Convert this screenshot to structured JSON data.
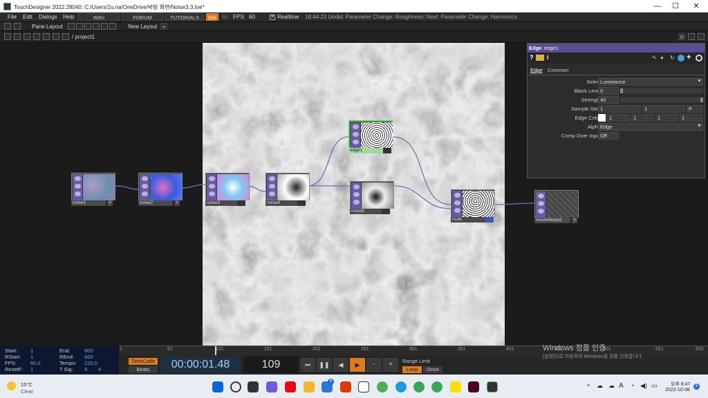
{
  "window": {
    "title": "TouchDesigner 2022.28040: C:/Users/2u.na/OneDrive/바탕 화면/Noise3.3.toe*",
    "controls": {
      "minimize": "—",
      "maximize": "☐",
      "close": "✕"
    }
  },
  "menu": {
    "items": [
      "File",
      "Edit",
      "Dialogs",
      "Help"
    ],
    "wiki": "WIKI",
    "forum": "FORUM",
    "tutorials": "TUTORIALS",
    "oh_label": "OH",
    "fps_target": "60",
    "fps_label": "FPS:",
    "fps_value": "60",
    "realtime_label": "Realtime",
    "undo_status": "18:44:23 Undid: Parameter Change: Roughness; Next: Parameter Change: Harmonics"
  },
  "toolbar": {
    "pane_layout": "Pane Layout",
    "new_layout": "New Layout",
    "plus": "+",
    "path": "/ project1",
    "right_0": "0"
  },
  "nodes": [
    {
      "label": "noise1",
      "thumb": "#7a8aa6"
    },
    {
      "label": "noise2",
      "thumb": "#4e6fd0"
    },
    {
      "label": "noise3",
      "thumb": "#7ab8e0"
    },
    {
      "label": "noise4",
      "thumb": "#bbbbbb"
    },
    {
      "label": "edge1",
      "thumb": "#cccccc"
    },
    {
      "label": "noise5",
      "thumb": "#aaaaaa"
    },
    {
      "label": "multi",
      "thumb": "#e8e8e8"
    },
    {
      "label": "moviefileout1",
      "thumb": "#444444"
    }
  ],
  "params": {
    "op_type": "Edge",
    "op_name": "edge1",
    "tabs": [
      "Edge",
      "Common"
    ],
    "rows": [
      {
        "label": "Select",
        "values": [
          "Luminance"
        ]
      },
      {
        "label": "Black Level",
        "values": [
          "0"
        ]
      },
      {
        "label": "Strength",
        "values": [
          "40"
        ]
      },
      {
        "label": "Sample Step",
        "values": [
          "1",
          "1",
          "P"
        ]
      },
      {
        "label": "Edge Color",
        "values": [
          "1",
          "1",
          "1",
          "1"
        ]
      },
      {
        "label": "Alpha",
        "values": [
          "Edge"
        ]
      },
      {
        "label": "Comp Over Input",
        "values": [
          "Off"
        ]
      }
    ]
  },
  "stats": {
    "start_label": "Start:",
    "start": "1",
    "end_label": "End:",
    "end": "600",
    "rstart_label": "RStart:",
    "rstart": "1",
    "rend_label": "REnd:",
    "rend": "600",
    "fps_label": "FPS:",
    "fps": "60.0",
    "tempo_label": "Tempo:",
    "tempo": "120.0",
    "resetf_label": "ResetF:",
    "resetf": "1",
    "tsig_label": "T Sig:",
    "tsig_a": "4",
    "tsig_b": "4"
  },
  "ruler": [
    "1",
    "51",
    "101",
    "151",
    "201",
    "251",
    "301",
    "351",
    "401",
    "451",
    "501",
    "551",
    "600"
  ],
  "transport": {
    "timecode_label": "TimeCode",
    "beats_label": "Beats",
    "timecode": "00:00:01.48",
    "frame": "109",
    "minus": "-",
    "plus": "+",
    "range_limit_label": "Range Limit",
    "loop_label": "Loop",
    "once_label": "Once"
  },
  "watermark": {
    "title": "Windows 정품 인증",
    "subtitle": "[설정]으로 이동하여 Windows를 정품 인증합니다."
  },
  "taskbar": {
    "weather_temp": "15°C",
    "weather_desc": "Clear",
    "lang": "A",
    "time": "오후 6:47",
    "date": "2022-10-08",
    "badge_chat": "6",
    "notify_count": "9"
  }
}
